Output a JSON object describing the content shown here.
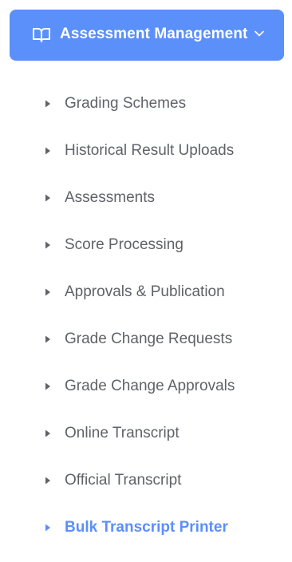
{
  "colors": {
    "accent": "#5b8ff9",
    "text": "#5f6368",
    "caret": "#5f6368",
    "active": "#5b8ff9",
    "header_text": "#ffffff"
  },
  "header": {
    "title": "Assessment Management",
    "icon": "book-open-icon",
    "chevron_icon": "chevron-down-icon"
  },
  "menu": {
    "items": [
      {
        "label": "Grading Schemes",
        "active": false
      },
      {
        "label": "Historical Result Uploads",
        "active": false
      },
      {
        "label": "Assessments",
        "active": false
      },
      {
        "label": "Score Processing",
        "active": false
      },
      {
        "label": "Approvals & Publication",
        "active": false
      },
      {
        "label": "Grade Change Requests",
        "active": false
      },
      {
        "label": "Grade Change Approvals",
        "active": false
      },
      {
        "label": "Online Transcript",
        "active": false
      },
      {
        "label": "Official Transcript",
        "active": false
      },
      {
        "label": "Bulk Transcript Printer",
        "active": true
      }
    ]
  }
}
